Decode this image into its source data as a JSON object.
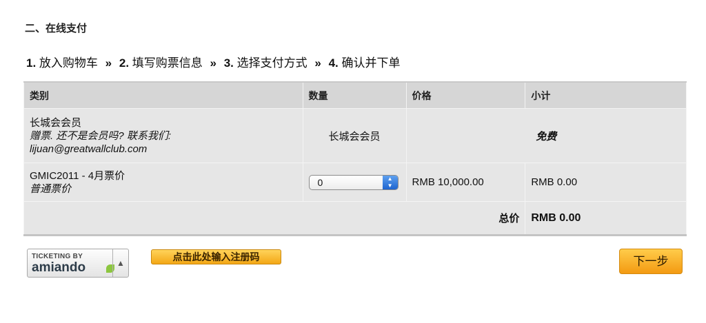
{
  "section_title": "二、在线支付",
  "steps": [
    {
      "num": "1.",
      "label": "放入购物车"
    },
    {
      "num": "2.",
      "label": "填写购票信息"
    },
    {
      "num": "3.",
      "label": "选择支付方式"
    },
    {
      "num": "4.",
      "label": "确认并下单"
    }
  ],
  "step_separator": "»",
  "table": {
    "headers": {
      "category": "类别",
      "quantity": "数量",
      "price": "价格",
      "subtotal": "小计"
    },
    "rows": [
      {
        "name": "长城会会员",
        "note_line1": "赠票. 还不是会员吗? 联系我们:",
        "note_line2": "lijuan@greatwallclub.com",
        "quantity_text": "长城会会员",
        "price_text": "免费"
      },
      {
        "name": "GMIC2011 - 4月票价",
        "note": "普通票价",
        "quantity_value": "0",
        "price": "RMB 10,000.00",
        "subtotal": "RMB 0.00"
      }
    ],
    "total_label": "总价",
    "total_value": "RMB 0.00"
  },
  "ticketing": {
    "by_label": "TICKETING BY",
    "brand": "amiando",
    "toggle_icon": "▲"
  },
  "register_code_button": "点击此处输入注册码",
  "next_button": "下一步",
  "colors": {
    "accent_orange": "#f3a716",
    "table_bg": "#e6e6e6",
    "header_bg": "#d6d6d6",
    "select_arrow": "#1e64cf"
  }
}
